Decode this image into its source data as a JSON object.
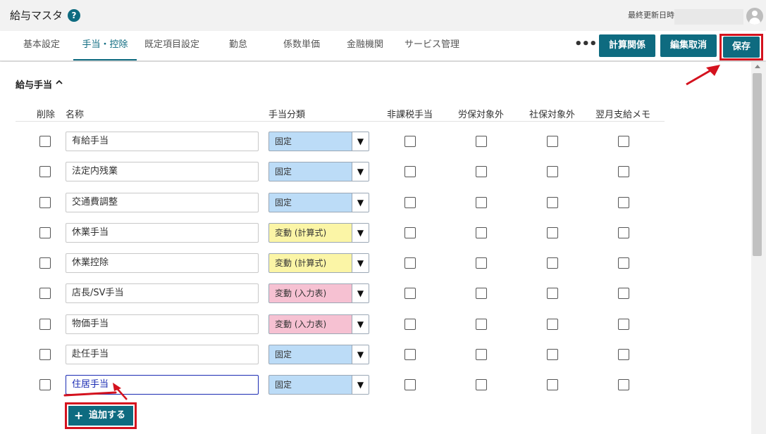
{
  "app": {
    "title": "給与マスタ",
    "help_icon": "?",
    "updated_label": "最終更新日時"
  },
  "tabs": [
    "基本設定",
    "手当・控除",
    "既定項目設定",
    "勤怠",
    "係数単価",
    "金融機関",
    "サービス管理"
  ],
  "active_tab": "手当・控除",
  "toolbar": {
    "more_icon": "•••",
    "calc_label": "計算関係",
    "cancel_label": "編集取消",
    "save_label": "保存"
  },
  "section": {
    "title": "給与手当",
    "toggle_icon": "chevron-up-icon"
  },
  "columns": {
    "delete": "削除",
    "name": "名称",
    "category": "手当分類",
    "tax_free": "非課税手当",
    "labor_excl": "労保対象外",
    "social_excl": "社保対象外",
    "next_month_memo": "翌月支給メモ"
  },
  "rows": [
    {
      "name": "有給手当",
      "category": "固定",
      "cat_kind": "fixed"
    },
    {
      "name": "法定内残業",
      "category": "固定",
      "cat_kind": "fixed"
    },
    {
      "name": "交通費調整",
      "category": "固定",
      "cat_kind": "fixed"
    },
    {
      "name": "休業手当",
      "category": "変動 (計算式)",
      "cat_kind": "formula"
    },
    {
      "name": "休業控除",
      "category": "変動 (計算式)",
      "cat_kind": "formula"
    },
    {
      "name": "店長/SV手当",
      "category": "変動 (入力表)",
      "cat_kind": "input"
    },
    {
      "name": "物価手当",
      "category": "変動 (入力表)",
      "cat_kind": "input"
    },
    {
      "name": "赴任手当",
      "category": "固定",
      "cat_kind": "fixed"
    },
    {
      "name": "住居手当",
      "category": "固定",
      "cat_kind": "fixed",
      "focused": true
    }
  ],
  "add_button": {
    "label": "追加する",
    "icon": "plus-icon"
  },
  "colors": {
    "accent": "#0e6b80",
    "fixed": "#bcdcf7",
    "formula": "#fbf5a6",
    "input": "#f6c1d2",
    "annotation": "#d4121e"
  }
}
